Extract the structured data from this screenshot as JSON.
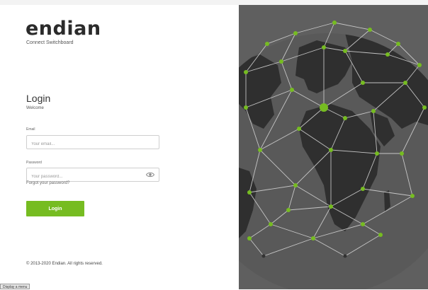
{
  "brand": {
    "logo": "endian",
    "subtitle": "Connect Switchboard"
  },
  "login": {
    "title": "Login",
    "welcome": "Welcome",
    "email": {
      "label": "Email",
      "placeholder": "Your email...",
      "value": ""
    },
    "password": {
      "label": "Password",
      "placeholder": "Your password...",
      "value": ""
    },
    "forgot_link": "Forgot your password?",
    "submit_label": "Login"
  },
  "footer": {
    "copyright": "© 2013-2020 Endian. All rights reserved."
  },
  "bottom_bar": {
    "menu_button": "Display a menu"
  },
  "icons": {
    "password_toggle": "eye-icon"
  },
  "colors": {
    "accent": "#76bc21",
    "panel_bg": "#5f5f5f",
    "globe_land": "#2f2f2f",
    "globe_lines": "#d0d0d0"
  }
}
